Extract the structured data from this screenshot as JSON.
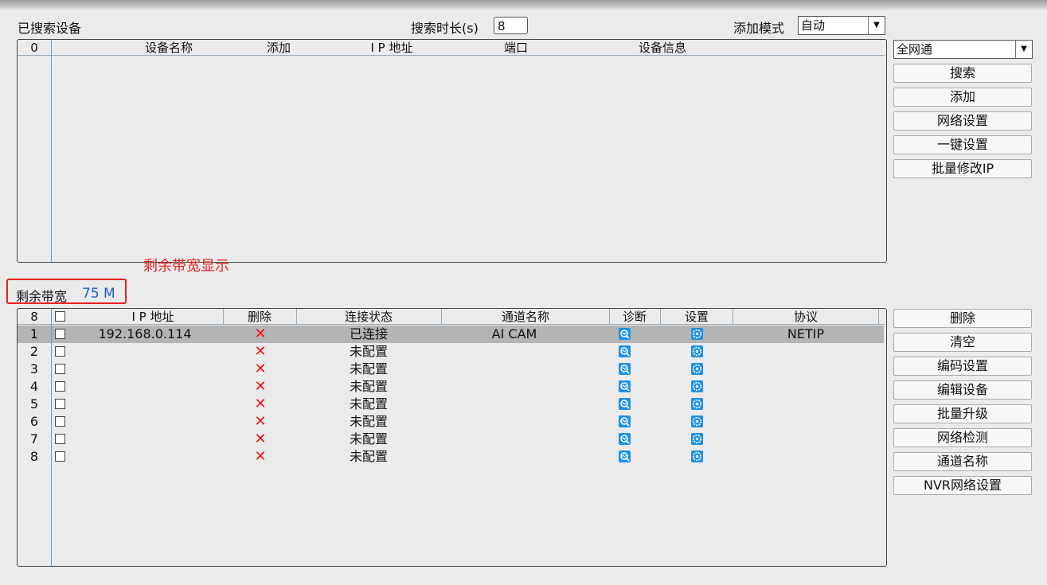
{
  "header": {
    "searched_devices_label": "已搜索设备",
    "search_duration_label": "搜索时长(s)",
    "search_duration_value": "8",
    "add_mode_label": "添加模式",
    "add_mode_value": "自动"
  },
  "search_table": {
    "count": "0",
    "columns": [
      "设备名称",
      "添加",
      "I P 地址",
      "端口",
      "设备信息"
    ]
  },
  "right_top": {
    "network_select": "全网通",
    "buttons": [
      "搜索",
      "添加",
      "网络设置",
      "一键设置",
      "批量修改IP"
    ]
  },
  "annotation": {
    "text": "剩余带宽显示",
    "color": "#e8201c"
  },
  "bandwidth": {
    "label": "剩余带宽",
    "value": "75 M",
    "value_color": "#1a5fd0"
  },
  "channel_table": {
    "count": "8",
    "columns": [
      "I P 地址",
      "删除",
      "连接状态",
      "通道名称",
      "诊断",
      "设置",
      "协议"
    ],
    "rows": [
      {
        "no": "1",
        "ip": "192.168.0.114",
        "delete": "✕",
        "status": "已连接",
        "name": "AI CAM",
        "protocol": "NETIP"
      },
      {
        "no": "2",
        "ip": "",
        "delete": "✕",
        "status": "未配置",
        "name": "",
        "protocol": ""
      },
      {
        "no": "3",
        "ip": "",
        "delete": "✕",
        "status": "未配置",
        "name": "",
        "protocol": ""
      },
      {
        "no": "4",
        "ip": "",
        "delete": "✕",
        "status": "未配置",
        "name": "",
        "protocol": ""
      },
      {
        "no": "5",
        "ip": "",
        "delete": "✕",
        "status": "未配置",
        "name": "",
        "protocol": ""
      },
      {
        "no": "6",
        "ip": "",
        "delete": "✕",
        "status": "未配置",
        "name": "",
        "protocol": ""
      },
      {
        "no": "7",
        "ip": "",
        "delete": "✕",
        "status": "未配置",
        "name": "",
        "protocol": ""
      },
      {
        "no": "8",
        "ip": "",
        "delete": "✕",
        "status": "未配置",
        "name": "",
        "protocol": ""
      }
    ],
    "icons": {
      "diagnose": "diagnose-icon",
      "settings": "settings-icon",
      "delete": "delete-x-icon"
    }
  },
  "right_bottom": {
    "buttons": [
      "删除",
      "清空",
      "编码设置",
      "编辑设备",
      "批量升级",
      "网络检测",
      "通道名称",
      "NVR网络设置"
    ]
  }
}
